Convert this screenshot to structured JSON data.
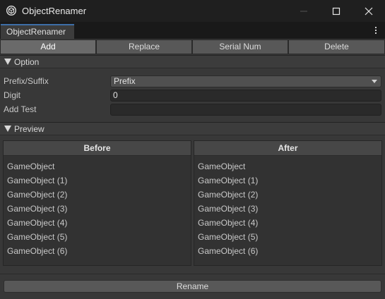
{
  "window": {
    "title": "ObjectRenamer",
    "icon": "unity-logo-icon"
  },
  "tab": {
    "label": "ObjectRenamer",
    "more_icon": "kebab-menu-icon"
  },
  "toolbar": {
    "buttons": [
      "Add",
      "Replace",
      "Serial Num",
      "Delete"
    ],
    "active": "Add"
  },
  "option": {
    "header": "Option",
    "prefix_suffix_label": "Prefix/Suffix",
    "prefix_suffix_value": "Prefix",
    "digit_label": "Digit",
    "digit_value": "0",
    "add_test_label": "Add Test",
    "add_test_value": ""
  },
  "preview": {
    "header": "Preview",
    "before_title": "Before",
    "after_title": "After",
    "before": [
      "GameObject",
      "GameObject (1)",
      "GameObject (2)",
      "GameObject (3)",
      "GameObject (4)",
      "GameObject (5)",
      "GameObject (6)"
    ],
    "after": [
      "GameObject",
      "GameObject (1)",
      "GameObject (2)",
      "GameObject (3)",
      "GameObject (4)",
      "GameObject (5)",
      "GameObject (6)"
    ]
  },
  "rename_button": "Rename",
  "colors": {
    "accent": "#3d6ea8",
    "window_bg": "#383838",
    "titlebar_bg": "#1f1f1f"
  }
}
